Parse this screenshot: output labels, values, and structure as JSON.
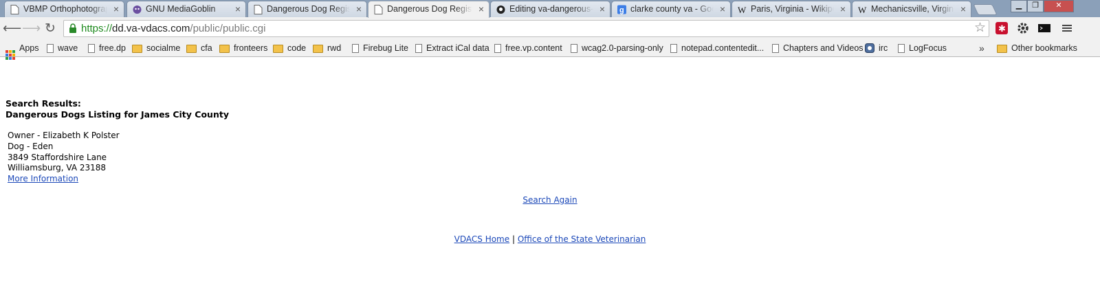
{
  "tabs": [
    {
      "title": "VBMP Orthophotograph",
      "icon": "page-icon",
      "active": false
    },
    {
      "title": "GNU MediaGoblin",
      "icon": "goblin-icon",
      "active": false
    },
    {
      "title": "Dangerous Dog Registry",
      "icon": "page-icon",
      "active": false
    },
    {
      "title": "Dangerous Dog Registry",
      "icon": "page-icon",
      "active": true
    },
    {
      "title": "Editing va-dangerous-dogs",
      "icon": "github-icon",
      "active": false
    },
    {
      "title": "clarke county va - Google",
      "icon": "google-icon",
      "active": false
    },
    {
      "title": "Paris, Virginia - Wikipedia",
      "icon": "wikipedia-icon",
      "active": false
    },
    {
      "title": "Mechanicsville, Virginia",
      "icon": "wikipedia-icon",
      "active": false
    }
  ],
  "toolbar": {
    "url_scheme": "https://",
    "url_host": "dd.va-vdacs.com",
    "url_path": "/public/public.cgi"
  },
  "bookmarks": {
    "items": [
      {
        "label": "Apps",
        "icon": "apps-icon"
      },
      {
        "label": "wave",
        "icon": "page-icon"
      },
      {
        "label": "free.dp",
        "icon": "page-icon"
      },
      {
        "label": "socialme",
        "icon": "folder-icon"
      },
      {
        "label": "cfa",
        "icon": "folder-icon"
      },
      {
        "label": "fronteers",
        "icon": "folder-icon"
      },
      {
        "label": "code",
        "icon": "folder-icon"
      },
      {
        "label": "rwd",
        "icon": "folder-icon"
      },
      {
        "label": "Firebug Lite",
        "icon": "page-icon"
      },
      {
        "label": "Extract iCal data",
        "icon": "page-icon"
      },
      {
        "label": "free.vp.content",
        "icon": "page-icon"
      },
      {
        "label": "wcag2.0-parsing-only",
        "icon": "page-icon"
      },
      {
        "label": "notepad.contentedit...",
        "icon": "page-icon"
      },
      {
        "label": "Chapters and Videos",
        "icon": "page-icon"
      },
      {
        "label": "irc",
        "icon": "irc-icon"
      },
      {
        "label": "LogFocus",
        "icon": "page-icon"
      }
    ],
    "more": "»",
    "other": "Other bookmarks"
  },
  "page": {
    "heading1": "Search Results:",
    "heading2": "Dangerous Dogs Listing for James City County",
    "record": {
      "owner": "Owner - Elizabeth K Polster",
      "dog": "Dog - Eden",
      "street": "3849 Staffordshire Lane",
      "city": "Williamsburg, VA 23188",
      "more_link": "More Information"
    },
    "search_again": "Search Again",
    "footer": {
      "home_link": "VDACS Home",
      "separator": "|",
      "vet_link": "Office of the State Veterinarian"
    }
  },
  "colors": {
    "link": "#1a47b8",
    "secure_scheme": "#1e8a1e",
    "tabstrip": "#8ba0b9"
  }
}
